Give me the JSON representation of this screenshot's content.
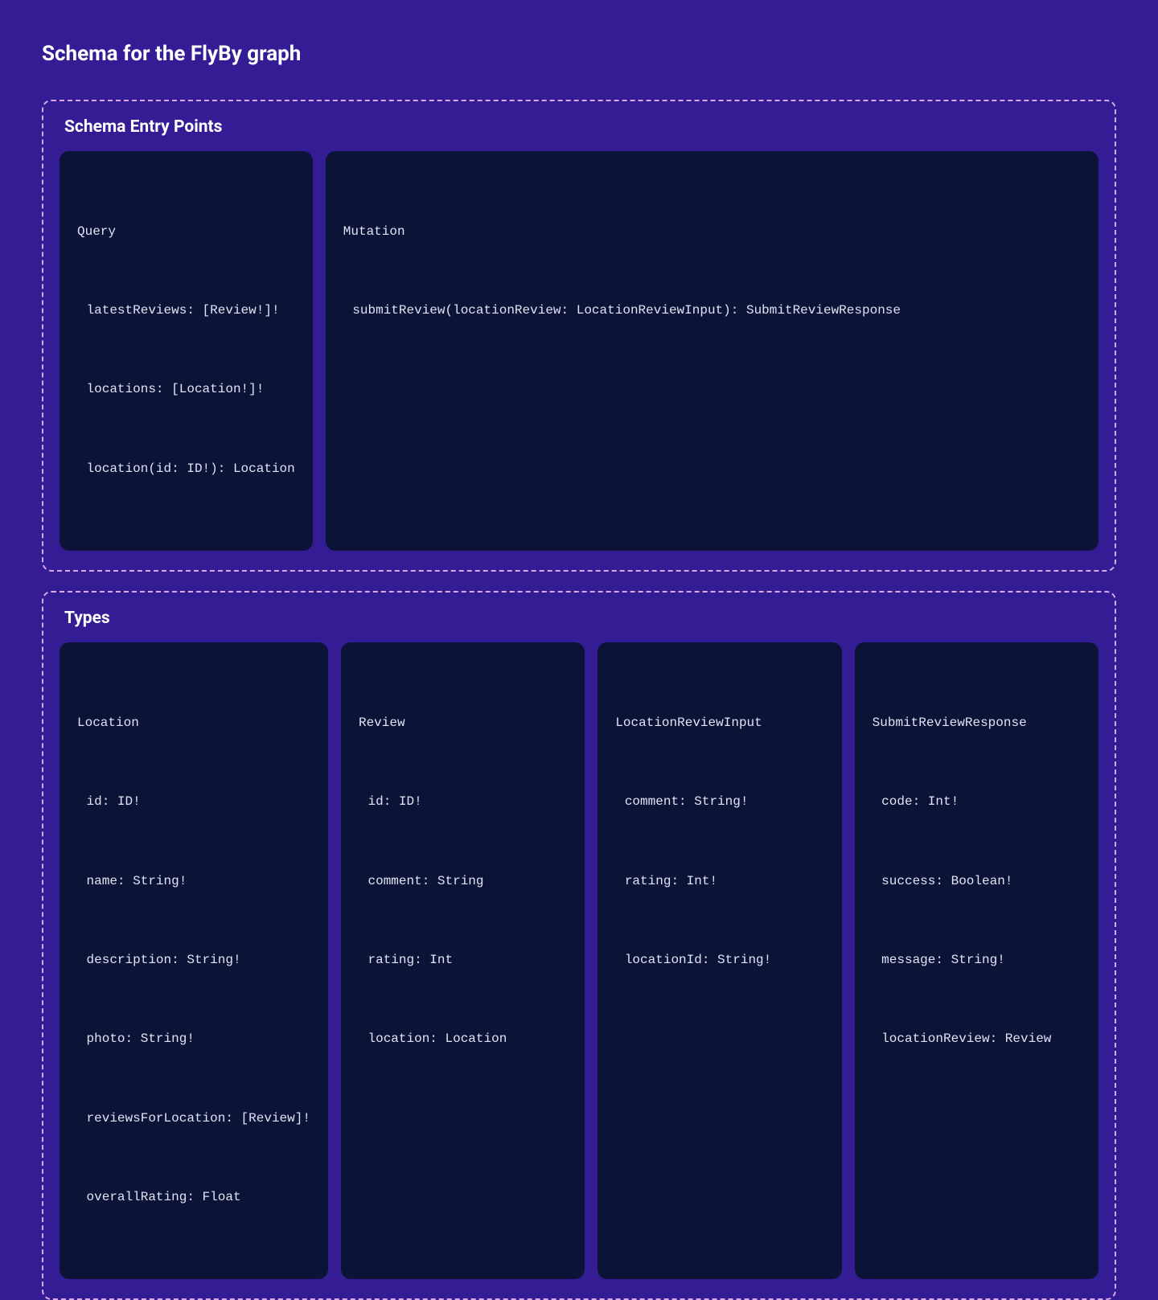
{
  "title": "Schema for the FlyBy graph",
  "sections": {
    "entryPoints": {
      "label": "Schema Entry Points",
      "query": {
        "name": "Query",
        "fields": [
          "latestReviews: [Review!]!",
          "locations: [Location!]!",
          "location(id: ID!): Location"
        ]
      },
      "mutation": {
        "name": "Mutation",
        "fields": [
          "submitReview(locationReview: LocationReviewInput): SubmitReviewResponse"
        ]
      }
    },
    "types": {
      "label": "Types",
      "items": [
        {
          "name": "Location",
          "fields": [
            "id: ID!",
            "name: String!",
            "description: String!",
            "photo: String!",
            "reviewsForLocation: [Review]!",
            "overallRating: Float"
          ]
        },
        {
          "name": "Review",
          "fields": [
            "id: ID!",
            "comment: String",
            "rating: Int",
            "location: Location"
          ]
        },
        {
          "name": "LocationReviewInput",
          "fields": [
            "comment: String!",
            "rating: Int!",
            "locationId: String!"
          ]
        },
        {
          "name": "SubmitReviewResponse",
          "fields": [
            "code: Int!",
            "success: Boolean!",
            "message: String!",
            "locationReview: Review"
          ]
        }
      ]
    }
  }
}
